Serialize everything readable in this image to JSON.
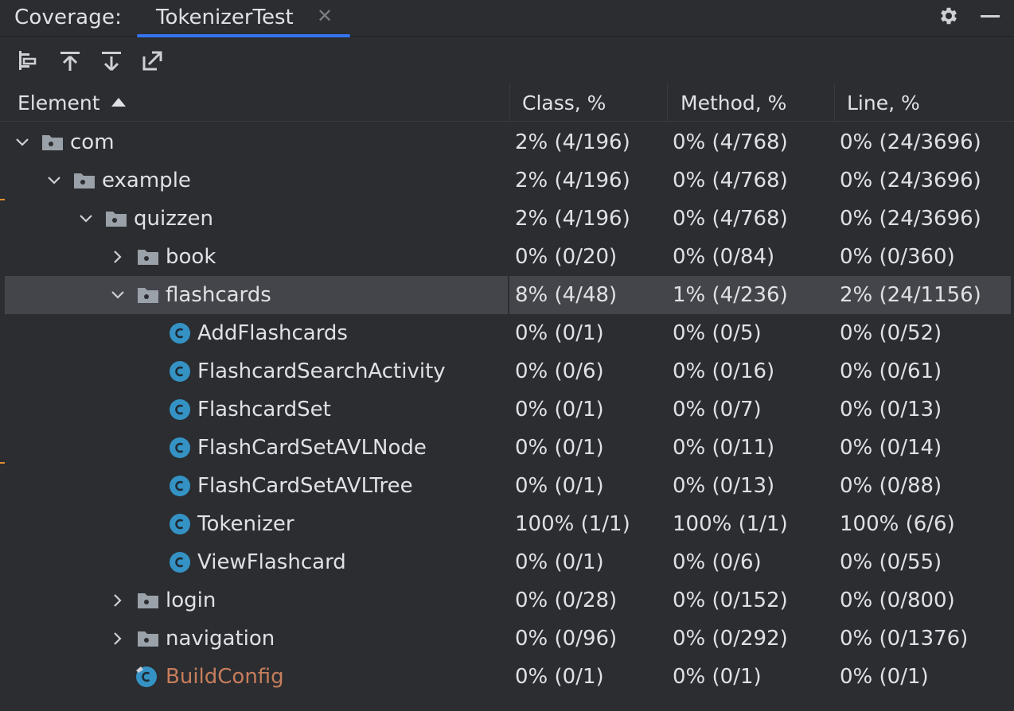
{
  "titlebar": {
    "label": "Coverage:",
    "tab_label": "TokenizerTest",
    "tab_close": "✕",
    "accent": "#3574f0"
  },
  "toolbar": {
    "icons": [
      "flatten-packages-icon",
      "navigate-up-icon",
      "navigate-down-icon",
      "export-icon"
    ]
  },
  "table": {
    "headers": {
      "element": "Element",
      "class": "Class, %",
      "method": "Method, %",
      "line": "Line, %"
    },
    "rows": [
      {
        "name": "com",
        "type": "package",
        "depth": 0,
        "expanded": true,
        "class": "2% (4/196)",
        "method": "0% (4/768)",
        "line": "0% (24/3696)"
      },
      {
        "name": "example",
        "type": "package",
        "depth": 1,
        "expanded": true,
        "class": "2% (4/196)",
        "method": "0% (4/768)",
        "line": "0% (24/3696)"
      },
      {
        "name": "quizzen",
        "type": "package",
        "depth": 2,
        "expanded": true,
        "class": "2% (4/196)",
        "method": "0% (4/768)",
        "line": "0% (24/3696)"
      },
      {
        "name": "book",
        "type": "package",
        "depth": 3,
        "expanded": false,
        "class": "0% (0/20)",
        "method": "0% (0/84)",
        "line": "0% (0/360)"
      },
      {
        "name": "flashcards",
        "type": "package",
        "depth": 3,
        "expanded": true,
        "selected": true,
        "class": "8% (4/48)",
        "method": "1% (4/236)",
        "line": "2% (24/1156)"
      },
      {
        "name": "AddFlashcards",
        "type": "class",
        "depth": 4,
        "class": "0% (0/1)",
        "method": "0% (0/5)",
        "line": "0% (0/52)"
      },
      {
        "name": "FlashcardSearchActivity",
        "type": "class",
        "depth": 4,
        "class": "0% (0/6)",
        "method": "0% (0/16)",
        "line": "0% (0/61)"
      },
      {
        "name": "FlashcardSet",
        "type": "class",
        "depth": 4,
        "class": "0% (0/1)",
        "method": "0% (0/7)",
        "line": "0% (0/13)"
      },
      {
        "name": "FlashCardSetAVLNode",
        "type": "class",
        "depth": 4,
        "class": "0% (0/1)",
        "method": "0% (0/11)",
        "line": "0% (0/14)"
      },
      {
        "name": "FlashCardSetAVLTree",
        "type": "class",
        "depth": 4,
        "class": "0% (0/1)",
        "method": "0% (0/13)",
        "line": "0% (0/88)"
      },
      {
        "name": "Tokenizer",
        "type": "class",
        "depth": 4,
        "class": "100% (1/1)",
        "method": "100% (1/1)",
        "line": "100% (6/6)"
      },
      {
        "name": "ViewFlashcard",
        "type": "class",
        "depth": 4,
        "class": "0% (0/1)",
        "method": "0% (0/6)",
        "line": "0% (0/55)"
      },
      {
        "name": "login",
        "type": "package",
        "depth": 3,
        "expanded": false,
        "class": "0% (0/28)",
        "method": "0% (0/152)",
        "line": "0% (0/800)"
      },
      {
        "name": "navigation",
        "type": "package",
        "depth": 3,
        "expanded": false,
        "class": "0% (0/96)",
        "method": "0% (0/292)",
        "line": "0% (0/1376)"
      },
      {
        "name": "BuildConfig",
        "type": "generated-class",
        "depth": 3,
        "class": "0% (0/1)",
        "method": "0% (0/1)",
        "line": "0% (0/1)"
      }
    ]
  },
  "colors": {
    "background": "#2b2d30",
    "selected_row": "#43454a",
    "class_icon": "#3592c4",
    "folder_icon": "#9aa1a8",
    "generated_text": "#c77d5c"
  }
}
